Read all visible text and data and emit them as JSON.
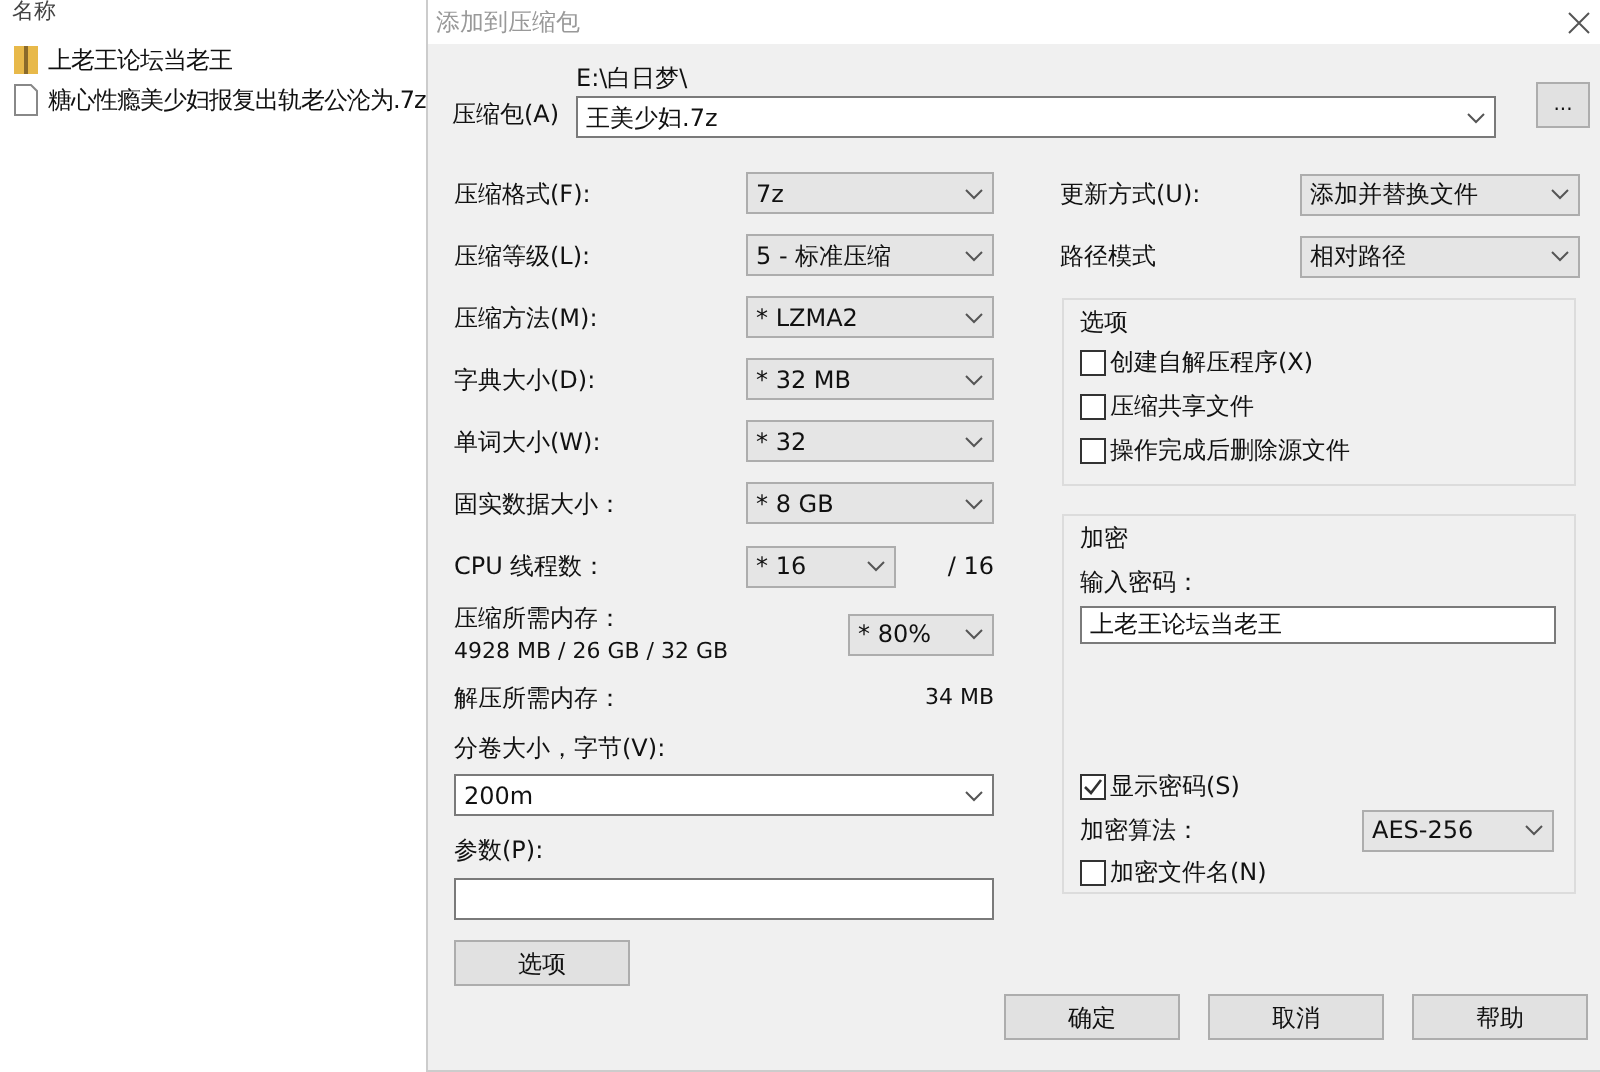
{
  "explorer": {
    "column_header": "名称",
    "items": [
      {
        "name": "上老王论坛当老王",
        "kind": "archive"
      },
      {
        "name": "糖心性瘾美少妇报复出轨老公沦为.7z",
        "kind": "file"
      }
    ]
  },
  "dialog": {
    "title": "添加到压缩包",
    "archive": {
      "label": "压缩包(A)",
      "path": "E:\\白日梦\\",
      "value": "王美少妇.7z",
      "browse": "..."
    },
    "left_fields": [
      {
        "label": "压缩格式(F):",
        "value": "7z"
      },
      {
        "label": "压缩等级(L):",
        "value": "5 - 标准压缩"
      },
      {
        "label": "压缩方法(M):",
        "value": "* LZMA2"
      },
      {
        "label": "字典大小(D):",
        "value": "* 32 MB"
      },
      {
        "label": "单词大小(W):",
        "value": "* 32"
      },
      {
        "label": "固实数据大小：",
        "value": "* 8 GB"
      }
    ],
    "cpu": {
      "label": "CPU 线程数：",
      "value": "* 16",
      "max": "/ 16"
    },
    "memory": {
      "label": "压缩所需内存：",
      "detail": "4928 MB / 26 GB / 32 GB",
      "value": "* 80%"
    },
    "decompress": {
      "label": "解压所需内存：",
      "value": "34 MB"
    },
    "split": {
      "label": "分卷大小，字节(V):",
      "value": "200m"
    },
    "params": {
      "label": "参数(P):"
    },
    "options_button": "选项",
    "update": {
      "label": "更新方式(U):",
      "value": "添加并替换文件"
    },
    "path_mode": {
      "label": "路径模式",
      "value": "相对路径"
    },
    "options_group": {
      "title": "选项",
      "items": [
        {
          "label": "创建自解压程序(X)",
          "checked": false
        },
        {
          "label": "压缩共享文件",
          "checked": false
        },
        {
          "label": "操作完成后删除源文件",
          "checked": false
        }
      ]
    },
    "encryption": {
      "title": "加密",
      "password_label": "输入密码：",
      "password": "上老王论坛当老王",
      "show_password": {
        "label": "显示密码(S)",
        "checked": true
      },
      "method_label": "加密算法：",
      "method": "AES-256",
      "encrypt_names": {
        "label": "加密文件名(N)",
        "checked": false
      }
    },
    "buttons": [
      "确定",
      "取消",
      "帮助"
    ]
  }
}
